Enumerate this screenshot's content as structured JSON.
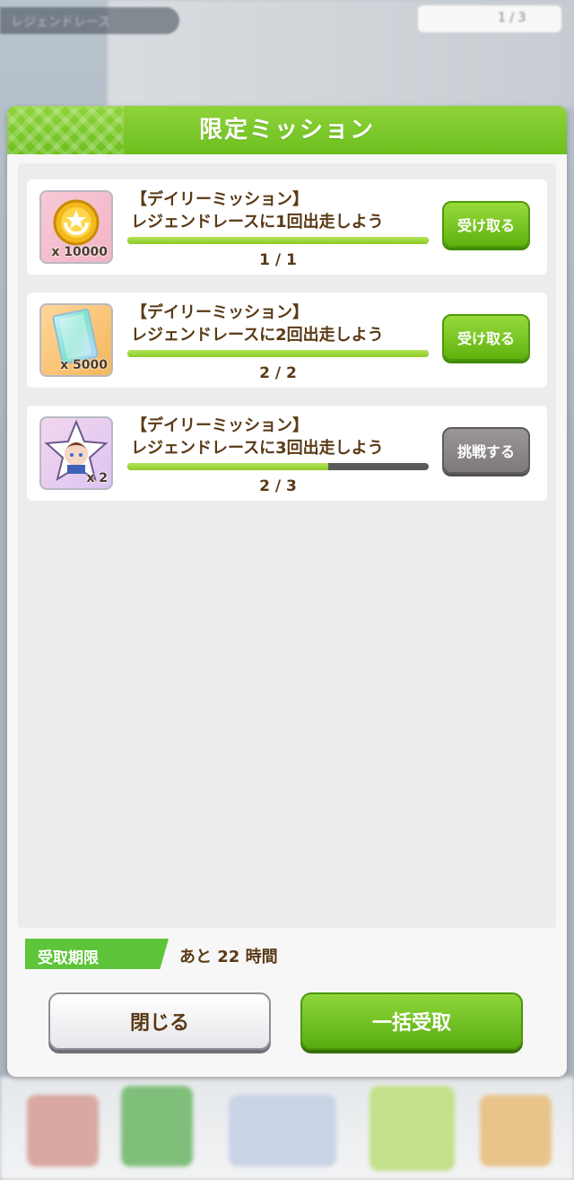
{
  "background": {
    "top_pill_label": "レジェンドレース",
    "top_counter": "1 / 3"
  },
  "modal": {
    "title": "限定ミッション",
    "missions": [
      {
        "reward_icon": "gold-coin-icon",
        "reward_qty": "x 10000",
        "line1": "【デイリーミッション】",
        "line2": "レジェンドレースに1回出走しよう",
        "progress_text": "1 / 1",
        "progress_fraction": 1.0,
        "button_label": "受け取る",
        "button_state": "claim"
      },
      {
        "reward_icon": "rainbow-ticket-icon",
        "reward_qty": "x 5000",
        "line1": "【デイリーミッション】",
        "line2": "レジェンドレースに2回出走しよう",
        "progress_text": "2 / 2",
        "progress_fraction": 1.0,
        "button_label": "受け取る",
        "button_state": "claim"
      },
      {
        "reward_icon": "character-piece-icon",
        "reward_qty": "x 2",
        "line1": "【デイリーミッション】",
        "line2": "レジェンドレースに3回出走しよう",
        "progress_text": "2 / 3",
        "progress_fraction": 0.667,
        "button_label": "挑戦する",
        "button_state": "challenge"
      }
    ],
    "deadline_label": "受取期限",
    "deadline_value": "あと 22 時間",
    "close_label": "閉じる",
    "claim_all_label": "一括受取"
  },
  "colors": {
    "accent_green": "#6cbf1e",
    "text_brown": "#5a3a16",
    "progress_fill": "#8ccc25"
  }
}
